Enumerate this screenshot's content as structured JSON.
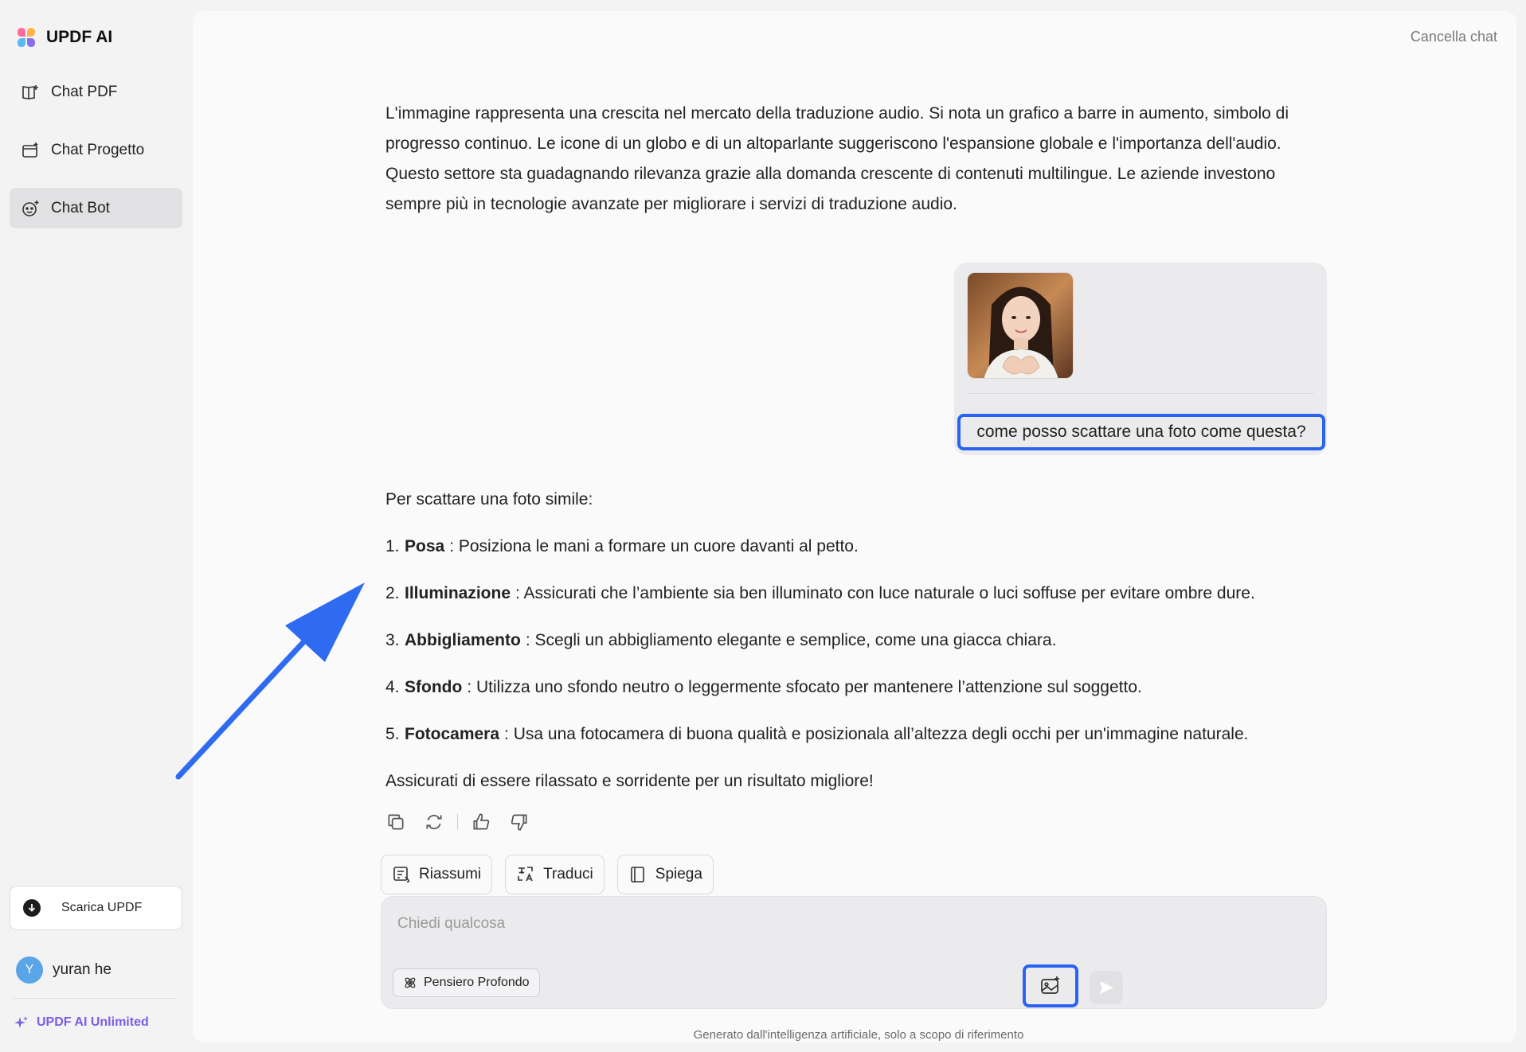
{
  "app": {
    "title": "UPDF AI"
  },
  "sidebar": {
    "items": [
      {
        "label": "Chat PDF",
        "icon": "book-icon"
      },
      {
        "label": "Chat Progetto",
        "icon": "folder-icon"
      },
      {
        "label": "Chat Bot",
        "icon": "bot-icon",
        "active": true
      }
    ],
    "download_label": "Scarica UPDF",
    "user": {
      "initial": "Y",
      "name": "yuran he"
    },
    "plan_label": "UPDF AI Unlimited"
  },
  "header": {
    "clear_chat": "Cancella chat"
  },
  "conversation": {
    "previous_answer": "L'immagine rappresenta una crescita nel mercato della traduzione audio. Si nota un grafico a barre in aumento, simbolo di progresso continuo. Le icone di un globo e di un altoparlante suggeriscono l'espansione globale e l'importanza dell'audio. Questo settore sta guadagnando rilevanza grazie alla domanda crescente di contenuti multilingue. Le aziende investono sempre più in tecnologie avanzate per migliorare i servizi di traduzione audio.",
    "user_question": "come posso scattare una foto come questa?",
    "answer": {
      "intro": "Per scattare una foto simile:",
      "items": [
        {
          "num": "1.",
          "title": "Posa",
          "text": ": Posiziona le mani a formare un cuore davanti al petto."
        },
        {
          "num": "2.",
          "title": "Illuminazione",
          "text": ": Assicurati che l’ambiente sia ben illuminato con luce naturale o luci soffuse per evitare ombre dure."
        },
        {
          "num": "3.",
          "title": "Abbigliamento",
          "text": ": Scegli un abbigliamento elegante e semplice, come una giacca chiara."
        },
        {
          "num": "4.",
          "title": "Sfondo",
          "text": ": Utilizza uno sfondo neutro o leggermente sfocato per mantenere l’attenzione sul soggetto."
        },
        {
          "num": "5.",
          "title": "Fotocamera",
          "text": ": Usa una fotocamera di buona qualità e posizionala all’altezza degli occhi per un'immagine naturale."
        }
      ],
      "outro": "Assicurati di essere rilassato e sorridente per un risultato migliore!"
    }
  },
  "quick_actions": [
    {
      "label": "Riassumi",
      "icon": "summary-icon"
    },
    {
      "label": "Traduci",
      "icon": "translate-icon"
    },
    {
      "label": "Spiega",
      "icon": "book-open-icon"
    }
  ],
  "composer": {
    "placeholder": "Chiedi qualcosa",
    "deep_thinking_label": "Pensiero Profondo"
  },
  "footer": {
    "disclaimer": "Generato dall'intelligenza artificiale, solo a scopo di riferimento"
  },
  "colors": {
    "accent_blue": "#2a63f2",
    "plan_purple": "#7b5ce6",
    "arrow_blue": "#2f6bf0"
  }
}
